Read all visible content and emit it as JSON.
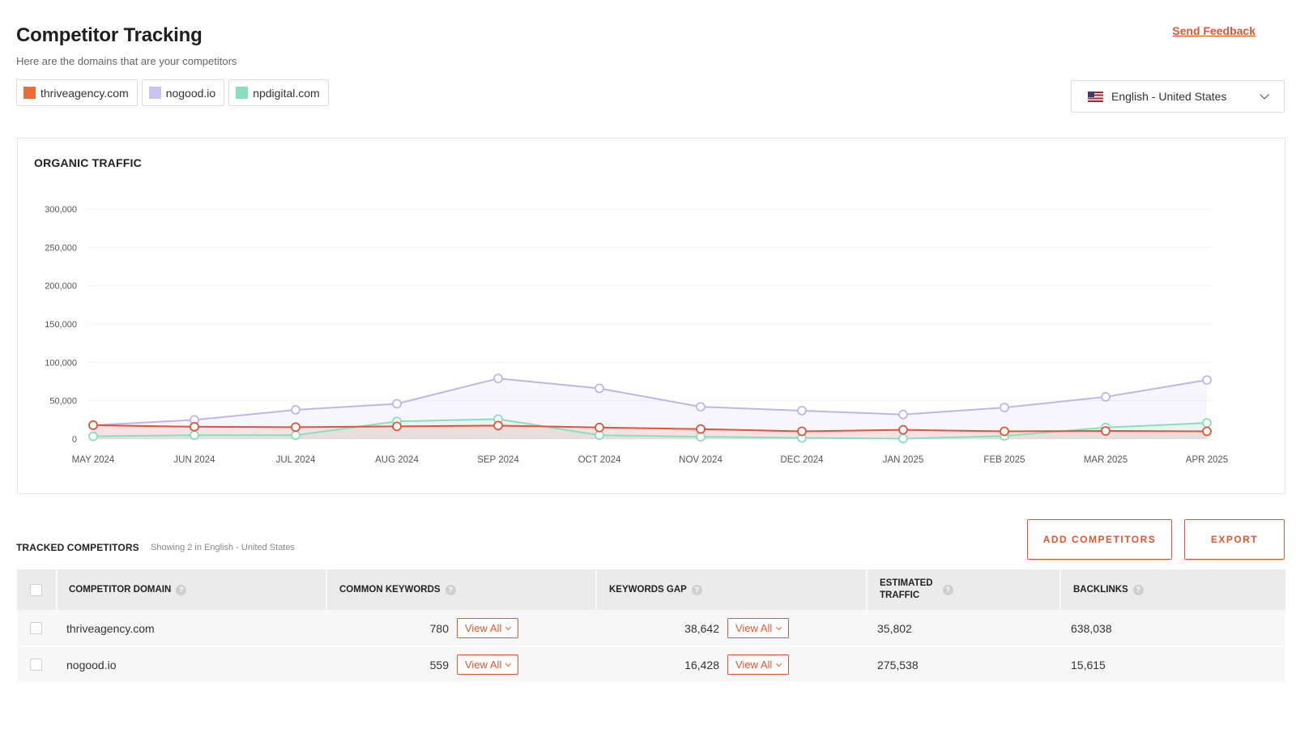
{
  "header": {
    "title": "Competitor Tracking",
    "subtitle": "Here are the domains that are your competitors",
    "feedback_link": "Send Feedback"
  },
  "legend": [
    {
      "label": "thriveagency.com",
      "color": "#f06a3c"
    },
    {
      "label": "nogood.io",
      "color": "#c9c3f2"
    },
    {
      "label": "npdigital.com",
      "color": "#87e0bb"
    }
  ],
  "language_select": {
    "selected": "English - United States",
    "flag_icon": "us-flag-icon"
  },
  "chart_data": {
    "type": "line",
    "title": "ORGANIC TRAFFIC",
    "x": [
      "MAY 2024",
      "JUN 2024",
      "JUL 2024",
      "AUG 2024",
      "SEP 2024",
      "OCT 2024",
      "NOV 2024",
      "DEC 2024",
      "JAN 2025",
      "FEB 2025",
      "MAR 2025",
      "APR 2025"
    ],
    "y_ticks": [
      "0",
      "50,000",
      "100,000",
      "150,000",
      "200,000",
      "250,000",
      "300,000"
    ],
    "ylim": [
      0,
      300000
    ],
    "grid": true,
    "area_fill": true,
    "series": [
      {
        "name": "nogood.io",
        "color": "#bdb6e9",
        "values": [
          18000,
          25000,
          38000,
          46000,
          79000,
          66000,
          42000,
          37000,
          32000,
          41000,
          55000,
          77000
        ]
      },
      {
        "name": "npdigital.com",
        "color": "#87e0bb",
        "values": [
          3500,
          5000,
          5000,
          23000,
          26000,
          5000,
          3000,
          1500,
          500,
          4000,
          15000,
          21000
        ]
      },
      {
        "name": "thriveagency.com",
        "color": "#e0553a",
        "values": [
          18000,
          16000,
          15500,
          16500,
          17500,
          15000,
          13000,
          10000,
          12000,
          10000,
          10500,
          10000
        ]
      }
    ]
  },
  "tracked": {
    "title": "TRACKED COMPETITORS",
    "subtitle": "Showing 2 in English - United States",
    "add_button": "ADD COMPETITORS",
    "export_button": "EXPORT"
  },
  "table": {
    "columns": [
      "COMPETITOR DOMAIN",
      "COMMON KEYWORDS",
      "KEYWORDS GAP",
      "ESTIMATED",
      "TRAFFIC",
      "BACKLINKS"
    ],
    "view_all_label": "View All",
    "rows": [
      {
        "domain": "thriveagency.com",
        "common_keywords": "780",
        "keywords_gap": "38,642",
        "estimated_traffic": "35,802",
        "backlinks": "638,038"
      },
      {
        "domain": "nogood.io",
        "common_keywords": "559",
        "keywords_gap": "16,428",
        "estimated_traffic": "275,538",
        "backlinks": "15,615"
      }
    ]
  }
}
